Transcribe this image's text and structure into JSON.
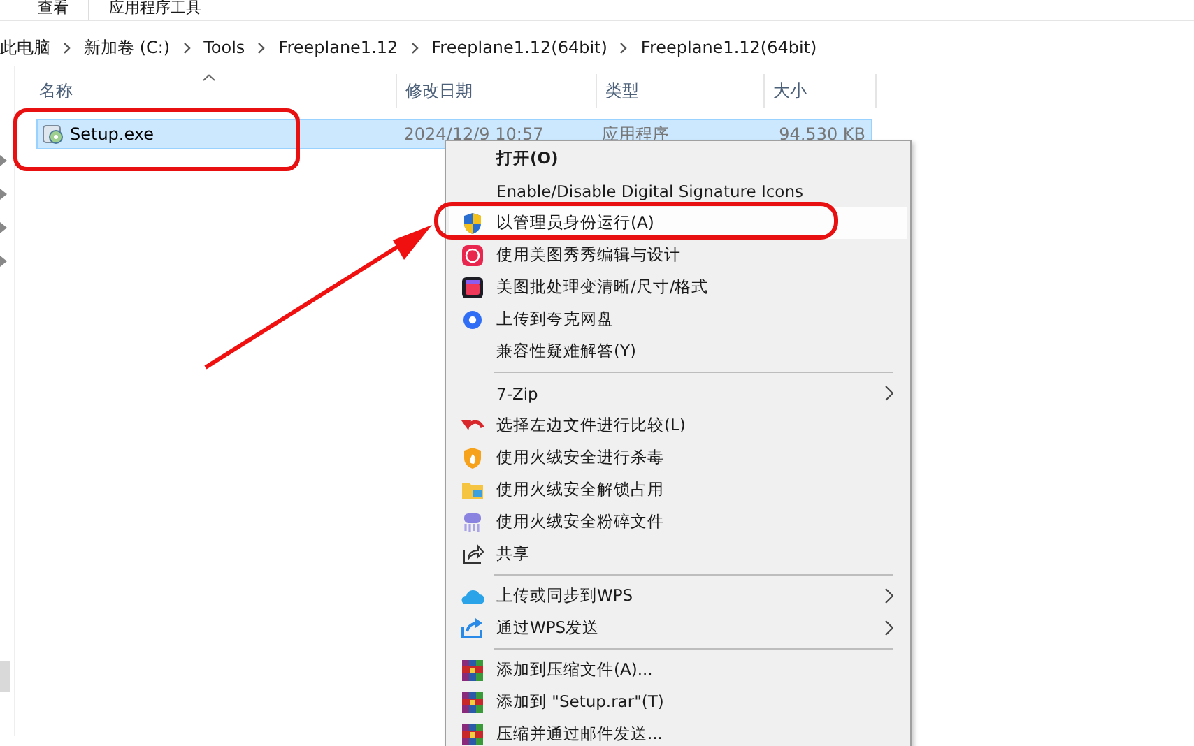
{
  "ribbon_tabs": [
    {
      "label": "查看"
    },
    {
      "label": "应用程序工具"
    }
  ],
  "address_bar": {
    "breadcrumbs": [
      "此电脑",
      "新加卷 (C:)",
      "Tools",
      "Freeplane1.12",
      "Freeplane1.12(64bit)",
      "Freeplane1.12(64bit)"
    ]
  },
  "file_list": {
    "columns": [
      "名称",
      "修改日期",
      "类型",
      "大小"
    ],
    "rows": [
      {
        "name": "Setup.exe",
        "modified": "2024/12/9 10:57",
        "type": "应用程序",
        "size": "94,530 KB",
        "selected": true
      }
    ]
  },
  "context_menu": {
    "groups": [
      [
        {
          "label": "打开(O)",
          "is_default": true,
          "selected": false,
          "submenu": false
        },
        {
          "label": "Enable/Disable Digital Signature Icons",
          "is_default": false,
          "selected": false,
          "submenu": false
        },
        {
          "label": "以管理员身份运行(A)",
          "is_default": false,
          "selected": true,
          "submenu": false
        },
        {
          "label": "使用美图秀秀编辑与设计",
          "is_default": false,
          "selected": false,
          "submenu": false
        },
        {
          "label": "美图批处理变清晰/尺寸/格式",
          "is_default": false,
          "selected": false,
          "submenu": false
        },
        {
          "label": "上传到夸克网盘",
          "is_default": false,
          "selected": false,
          "submenu": false
        },
        {
          "label": "兼容性疑难解答(Y)",
          "is_default": false,
          "selected": false,
          "submenu": false
        }
      ],
      [
        {
          "label": "7-Zip",
          "is_default": false,
          "selected": false,
          "submenu": true
        },
        {
          "label": "选择左边文件进行比较(L)",
          "is_default": false,
          "selected": false,
          "submenu": false
        },
        {
          "label": "使用火绒安全进行杀毒",
          "is_default": false,
          "selected": false,
          "submenu": false
        },
        {
          "label": "使用火绒安全解锁占用",
          "is_default": false,
          "selected": false,
          "submenu": false
        },
        {
          "label": "使用火绒安全粉碎文件",
          "is_default": false,
          "selected": false,
          "submenu": false
        },
        {
          "label": "共享",
          "is_default": false,
          "selected": false,
          "submenu": false
        }
      ],
      [
        {
          "label": "上传或同步到WPS",
          "is_default": false,
          "selected": false,
          "submenu": true
        },
        {
          "label": "通过WPS发送",
          "is_default": false,
          "selected": false,
          "submenu": true
        }
      ],
      [
        {
          "label": "添加到压缩文件(A)...",
          "is_default": false,
          "selected": false,
          "submenu": false
        },
        {
          "label": "添加到 \"Setup.rar\"(T)",
          "is_default": false,
          "selected": false,
          "submenu": false
        },
        {
          "label": "压缩并通过邮件发送...",
          "is_default": false,
          "selected": false,
          "submenu": false
        }
      ]
    ]
  }
}
